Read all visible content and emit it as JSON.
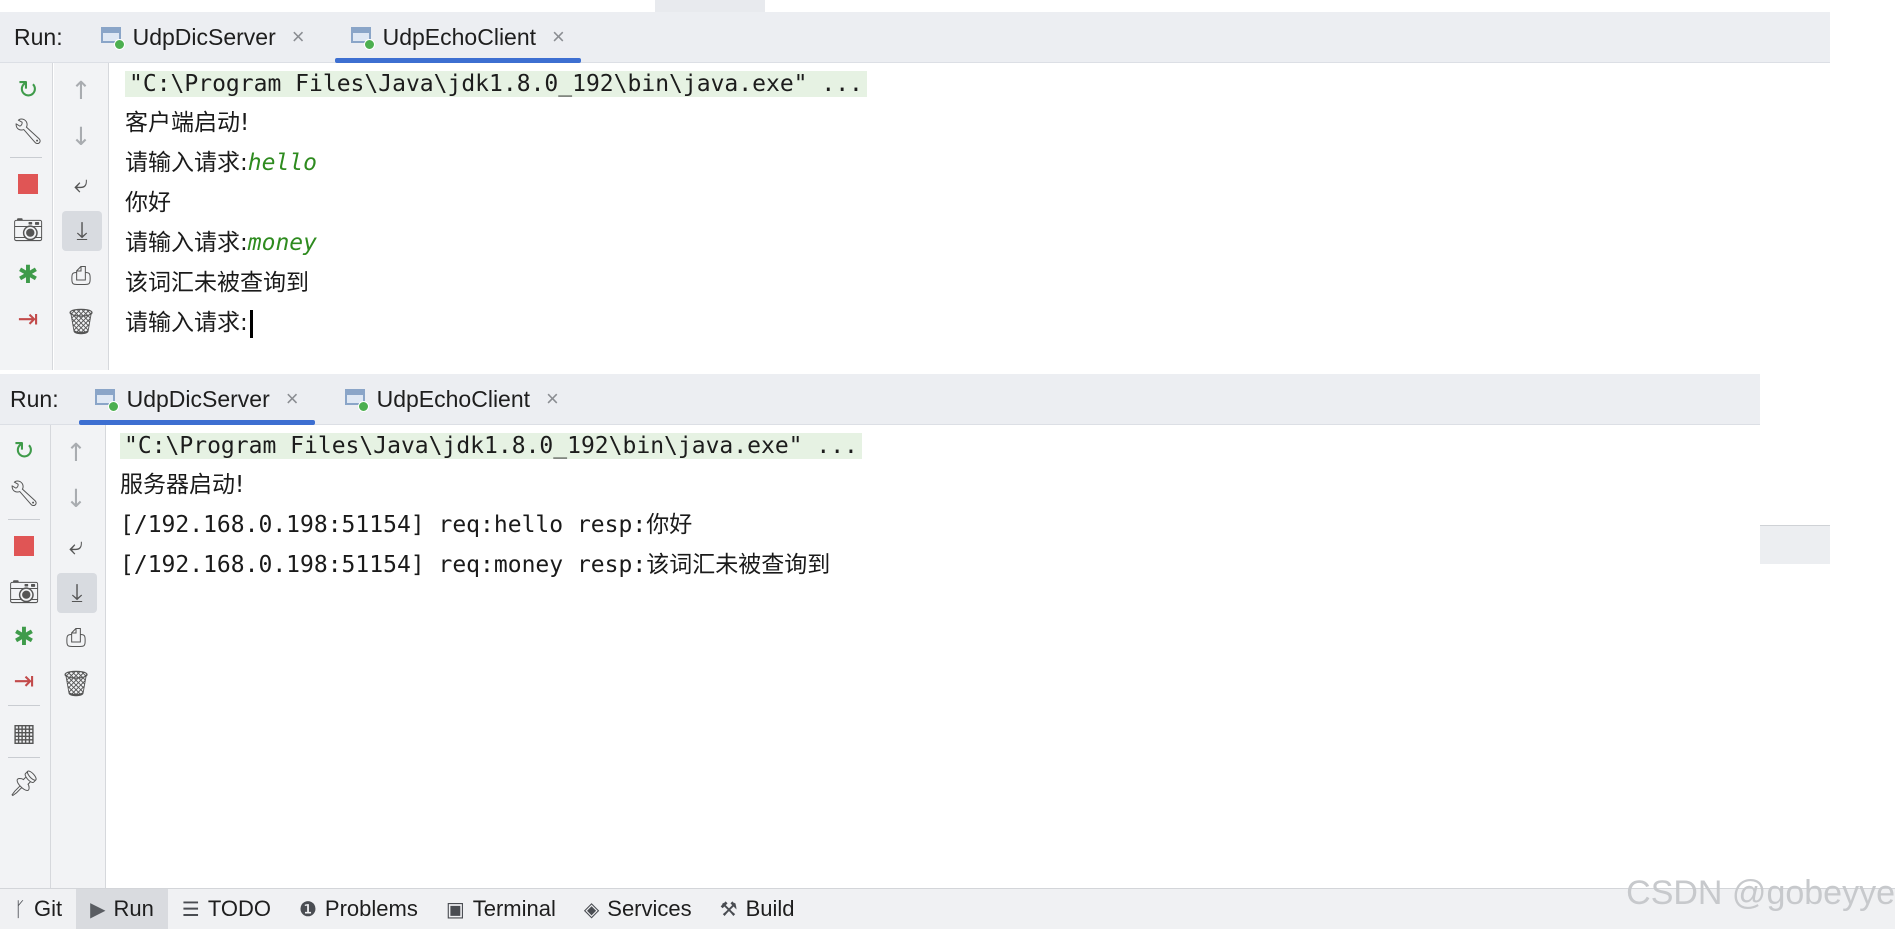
{
  "client_panel": {
    "run_label": "Run:",
    "tabs": [
      {
        "label": "UdpDicServer",
        "close": "×"
      },
      {
        "label": "UdpEchoClient",
        "close": "×"
      }
    ],
    "console": {
      "command": "\"C:\\Program Files\\Java\\jdk1.8.0_192\\bin\\java.exe\" ...",
      "lines": [
        {
          "text": "客户端启动!"
        },
        {
          "prompt": "请输入请求:",
          "input": "hello"
        },
        {
          "text": "你好"
        },
        {
          "prompt": "请输入请求:",
          "input": "money"
        },
        {
          "text": "该词汇未被查询到"
        },
        {
          "prompt": "请输入请求:",
          "input": ""
        }
      ]
    }
  },
  "server_panel": {
    "run_label": "Run:",
    "tabs": [
      {
        "label": "UdpDicServer",
        "close": "×"
      },
      {
        "label": "UdpEchoClient",
        "close": "×"
      }
    ],
    "console": {
      "command": "\"C:\\Program Files\\Java\\jdk1.8.0_192\\bin\\java.exe\" ...",
      "lines": [
        {
          "text": "服务器启动!"
        },
        {
          "mono": "[/192.168.0.198:51154] req:hello resp:",
          "cn": "你好"
        },
        {
          "mono": "[/192.168.0.198:51154] req:money resp:",
          "cn": "该词汇未被查询到"
        }
      ]
    }
  },
  "bottom_tabs": [
    {
      "label": "Git",
      "icon": "git-branch-icon"
    },
    {
      "label": "Run",
      "icon": "run-play-icon"
    },
    {
      "label": "TODO",
      "icon": "todo-list-icon"
    },
    {
      "label": "Problems",
      "icon": "problems-icon"
    },
    {
      "label": "Terminal",
      "icon": "terminal-icon"
    },
    {
      "label": "Services",
      "icon": "services-icon"
    },
    {
      "label": "Build",
      "icon": "build-hammer-icon"
    }
  ],
  "watermark": "CSDN @gobeyye",
  "colors": {
    "accent": "#3d6fd1",
    "input_green": "#2e8b1f",
    "command_bg": "#e6f2e3",
    "run_green": "#4caf50",
    "stop_red": "#e05555"
  }
}
